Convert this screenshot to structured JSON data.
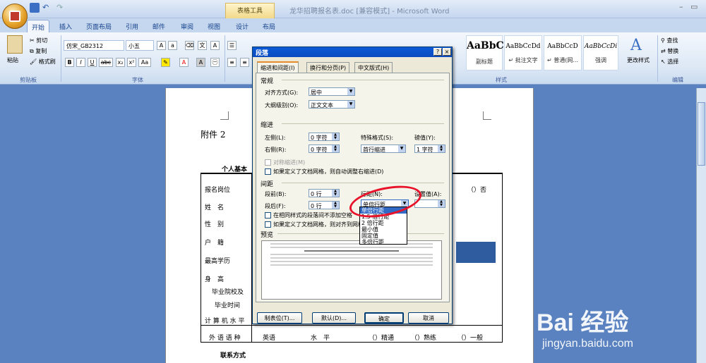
{
  "window": {
    "title": "龙华招聘报名表.doc [兼容模式] - Microsoft Word",
    "context_group": "表格工具"
  },
  "tabs": [
    "开始",
    "插入",
    "页面布局",
    "引用",
    "邮件",
    "审阅",
    "视图",
    "设计",
    "布局"
  ],
  "ribbon": {
    "clipboard": {
      "paste": "粘贴",
      "cut": "剪切",
      "copy": "复制",
      "format_painter": "格式刷",
      "label": "剪贴板"
    },
    "font": {
      "name": "仿宋_GB2312",
      "size": "小五",
      "label": "字体",
      "buttons": [
        "B",
        "I",
        "U",
        "abc",
        "x₂",
        "x²",
        "Aa"
      ]
    },
    "styles": {
      "cards": [
        {
          "sample": "AaBbCcDd",
          "label": "副标题"
        },
        {
          "sample": "AaBbCcDd",
          "label": "↵ 批注文字"
        },
        {
          "sample": "AaBbCcD",
          "label": "↵ 普通(网..."
        },
        {
          "sample": "AaBbCcDi",
          "label": "强调"
        }
      ],
      "change_styles": "更改样式",
      "label": "样式"
    },
    "editing": {
      "find": "查找",
      "replace": "替换",
      "select": "选择",
      "label": "编辑"
    }
  },
  "document": {
    "attachment": "附件 2",
    "table_title": "个人基本",
    "contact": "联系方式",
    "row_labels": [
      "报名岗位",
      "姓　名",
      "性　别",
      "户　籍",
      "最高学历",
      "身　高",
      "毕业院校及",
      "毕业时间",
      "计 算 机 水 平",
      "外 语 语 种"
    ],
    "bottom_row": [
      "英语",
      "水　平",
      "（）精通",
      "（）熟练",
      "（）一般"
    ],
    "right_header": "（）否"
  },
  "dialog": {
    "title": "段落",
    "help": "?",
    "close": "×",
    "tabs": [
      "缩进和间距(I)",
      "换行和分页(P)",
      "中文版式(H)"
    ],
    "general": {
      "heading": "常规",
      "alignment_label": "对齐方式(G):",
      "alignment_value": "居中",
      "outline_label": "大纲级别(O):",
      "outline_value": "正文文本"
    },
    "indent": {
      "heading": "缩进",
      "left_label": "左侧(L):",
      "left_value": "0 字符",
      "right_label": "右侧(R):",
      "right_value": "0 字符",
      "special_label": "特殊格式(S):",
      "special_value": "首行缩进",
      "by_label": "磅值(Y):",
      "by_value": "1 字符",
      "mirror": "对称缩进(M)",
      "auto_adjust": "如果定义了文档网格，则自动调整右缩进(D)"
    },
    "spacing": {
      "heading": "间距",
      "before_label": "段前(B):",
      "before_value": "0 行",
      "after_label": "段后(F):",
      "after_value": "0 行",
      "line_label": "行距(N):",
      "line_value": "单倍行距",
      "at_label": "设置值(A):",
      "no_space": "在相同样式的段落间不添加空格",
      "snap": "如果定义了文档网格，则对齐到网格"
    },
    "line_spacing_options": [
      "单倍行距",
      "1.5 倍行距",
      "2 倍行距",
      "最小值",
      "固定值",
      "多倍行距"
    ],
    "preview_heading": "预览",
    "buttons": {
      "tabs": "制表位(T)...",
      "default": "默认(D)...",
      "ok": "确定",
      "cancel": "取消"
    }
  },
  "watermark": {
    "brand": "Bai 经验",
    "url": "jingyan.baidu.com"
  },
  "colors": {
    "accent": "#e8132a",
    "selection": "#316ac5",
    "ribbon_text": "#15428b"
  }
}
